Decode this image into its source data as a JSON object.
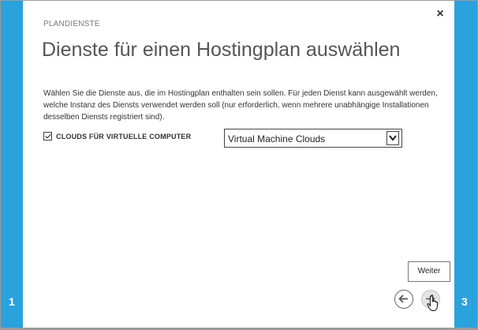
{
  "wizard": {
    "left_step": "1",
    "right_step": "3",
    "close_symbol": "×",
    "eyebrow": "PLANDIENSTE",
    "title": "Dienste für einen Hostingplan auswählen",
    "description": "Wählen Sie die Dienste aus, die im Hostingplan enthalten sein sollen. Für jeden Dienst kann ausgewählt werden, welche Instanz des Diensts verwendet werden soll (nur erforderlich, wenn mehrere unabhängige Installationen desselben Diensts registriert sind).",
    "service": {
      "checkbox_label": "CLOUDS FÜR VIRTUELLE COMPUTER",
      "checked": true,
      "select_value": "Virtual Machine Clouds"
    },
    "tooltip": "Weiter"
  },
  "icons": {
    "close": "close-icon",
    "prev": "arrow-left-icon",
    "next": "arrow-right-icon",
    "dropdown": "chevron-down-icon",
    "cursor": "hand-pointer-icon",
    "checkbox": "checkmark-icon"
  },
  "colors": {
    "accent": "#2aa2dd",
    "background": "#ffffff",
    "text": "#333333",
    "title": "#555555"
  }
}
